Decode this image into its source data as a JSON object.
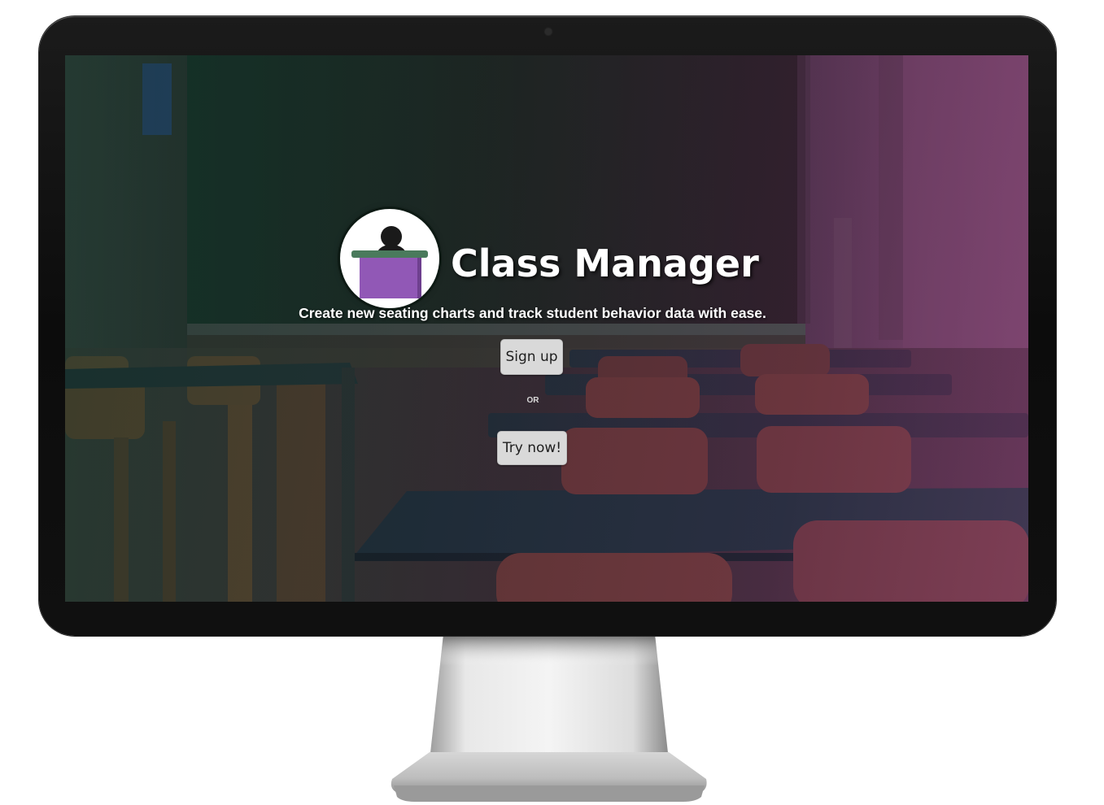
{
  "app": {
    "title": "Class Manager",
    "tagline": "Create new seating charts and track student behavior data with ease.",
    "logo_icon": "teacher-at-podium-icon"
  },
  "actions": {
    "signup_label": "Sign up",
    "separator": "OR",
    "try_label": "Try now!"
  },
  "colors": {
    "podium_purple": "#9158b6",
    "podium_top_green": "#4a7a5c",
    "title_text": "#ffffff",
    "button_bg": "#d9d9d9"
  }
}
